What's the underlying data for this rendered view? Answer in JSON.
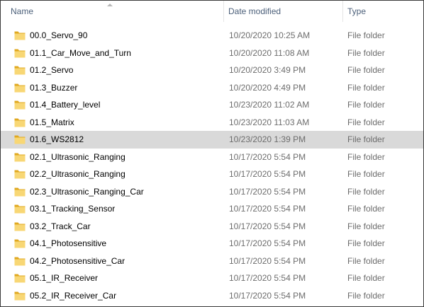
{
  "header": {
    "name_label": "Name",
    "date_label": "Date modified",
    "type_label": "Type"
  },
  "colors": {
    "folder_body": "#f8d775",
    "folder_back": "#e0a820",
    "header_text": "#4c607a",
    "selected_bg": "#d9d9d9",
    "secondary_text": "#6d6d6d"
  },
  "files": [
    {
      "name": "00.0_Servo_90",
      "date": "10/20/2020 10:25 AM",
      "type": "File folder",
      "icon": "folder-icon"
    },
    {
      "name": "01.1_Car_Move_and_Turn",
      "date": "10/20/2020 11:08 AM",
      "type": "File folder",
      "icon": "folder-icon"
    },
    {
      "name": "01.2_Servo",
      "date": "10/20/2020 3:49 PM",
      "type": "File folder",
      "icon": "folder-icon"
    },
    {
      "name": "01.3_Buzzer",
      "date": "10/20/2020 4:49 PM",
      "type": "File folder",
      "icon": "folder-icon"
    },
    {
      "name": "01.4_Battery_level",
      "date": "10/23/2020 11:02 AM",
      "type": "File folder",
      "icon": "folder-icon"
    },
    {
      "name": "01.5_Matrix",
      "date": "10/23/2020 11:03 AM",
      "type": "File folder",
      "icon": "folder-icon"
    },
    {
      "name": "01.6_WS2812",
      "date": "10/23/2020 1:39 PM",
      "type": "File folder",
      "icon": "folder-icon",
      "selected": true
    },
    {
      "name": "02.1_Ultrasonic_Ranging",
      "date": "10/17/2020 5:54 PM",
      "type": "File folder",
      "icon": "folder-icon"
    },
    {
      "name": "02.2_Ultrasonic_Ranging",
      "date": "10/17/2020 5:54 PM",
      "type": "File folder",
      "icon": "folder-icon"
    },
    {
      "name": "02.3_Ultrasonic_Ranging_Car",
      "date": "10/17/2020 5:54 PM",
      "type": "File folder",
      "icon": "folder-icon"
    },
    {
      "name": "03.1_Tracking_Sensor",
      "date": "10/17/2020 5:54 PM",
      "type": "File folder",
      "icon": "folder-icon"
    },
    {
      "name": "03.2_Track_Car",
      "date": "10/17/2020 5:54 PM",
      "type": "File folder",
      "icon": "folder-icon"
    },
    {
      "name": "04.1_Photosensitive",
      "date": "10/17/2020 5:54 PM",
      "type": "File folder",
      "icon": "folder-icon"
    },
    {
      "name": "04.2_Photosensitive_Car",
      "date": "10/17/2020 5:54 PM",
      "type": "File folder",
      "icon": "folder-icon"
    },
    {
      "name": "05.1_IR_Receiver",
      "date": "10/17/2020 5:54 PM",
      "type": "File folder",
      "icon": "folder-icon"
    },
    {
      "name": "05.2_IR_Receiver_Car",
      "date": "10/17/2020 5:54 PM",
      "type": "File folder",
      "icon": "folder-icon"
    }
  ]
}
